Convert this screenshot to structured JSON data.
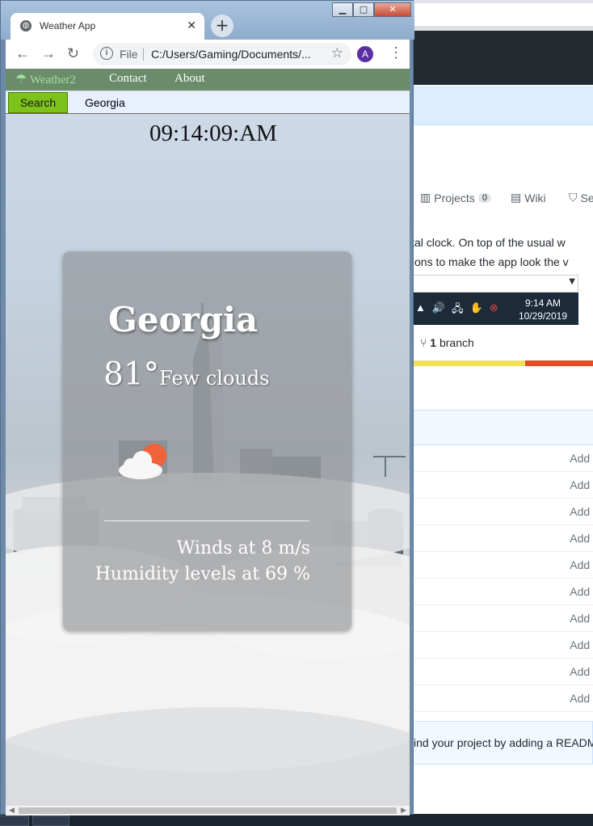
{
  "window": {
    "tab_title": "Weather App",
    "tab_close": "✕",
    "new_tab": "+",
    "controls": {
      "minimize": "▁",
      "maximize": "□",
      "close": "✕"
    }
  },
  "toolbar": {
    "back_icon": "back-arrow-icon",
    "forward_icon": "forward-arrow-icon",
    "reload_icon": "reload-icon",
    "info_glyph": "i",
    "file_label": "File",
    "url": "C:/Users/Gaming/Documents/...",
    "profile_initial": "A",
    "menu": "⋮"
  },
  "site": {
    "brand": "Weather2",
    "nav": {
      "contact": "Contact",
      "about": "About"
    },
    "search_button": "Search",
    "search_value": "Georgia",
    "clock": "09:14:09:AM"
  },
  "weather": {
    "city": "Georgia",
    "temperature": "81°",
    "description": "Few clouds",
    "winds": "Winds at 8 m/s",
    "humidity": "Humidity levels at 69 %",
    "icon": "partly-cloudy-icon"
  },
  "background_page": {
    "repo_tabs": [
      {
        "label": "Projects",
        "count": "0"
      },
      {
        "label": "Wiki"
      },
      {
        "label": "Se"
      }
    ],
    "description_lines": [
      "ital clock. On top of the usual w",
      "tions to make the app look the v"
    ],
    "tray_time": "9:14 AM",
    "tray_date": "10/29/2019",
    "branch_count": "1",
    "branch_label": "branch",
    "file_rows": [
      "Add f",
      "Add f",
      "Add f",
      "Add f",
      "Add f",
      "Add f",
      "Add f",
      "Add f",
      "Add f",
      "Add f"
    ],
    "readme_prompt": "ind your project by adding a READM"
  },
  "colors": {
    "nav_green": "#6b8c6a",
    "brand_green": "#9fe09f",
    "search_button": "#7cc21a",
    "search_row": "#e8f0fe",
    "card_overlay": "rgba(140,142,146,0.62)",
    "github_dark": "#24292e"
  }
}
